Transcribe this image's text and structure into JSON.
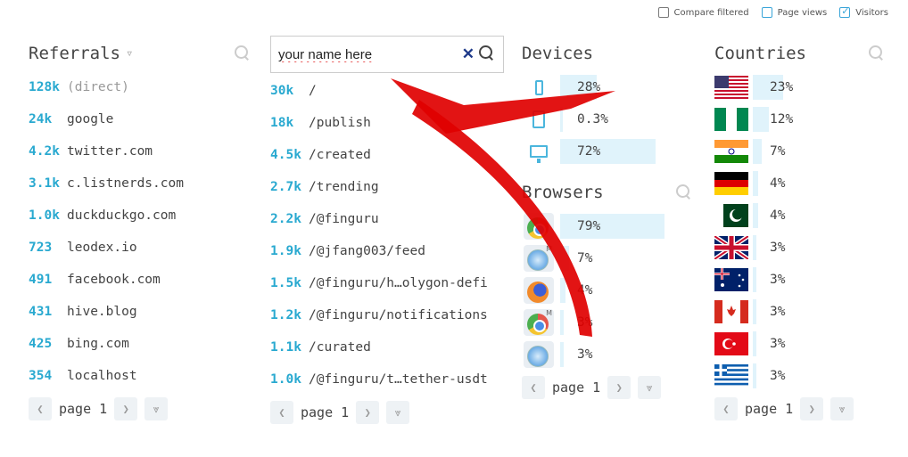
{
  "topbar": {
    "compare_label": "Compare filtered",
    "pageviews_label": "Page views",
    "visitors_label": "Visitors"
  },
  "referrals": {
    "title": "Referrals",
    "rows": [
      {
        "count": "128k",
        "label": "(direct)"
      },
      {
        "count": "24k",
        "label": "google"
      },
      {
        "count": "4.2k",
        "label": "twitter.com"
      },
      {
        "count": "3.1k",
        "label": "c.listnerds.com"
      },
      {
        "count": "1.0k",
        "label": "duckduckgo.com"
      },
      {
        "count": "723",
        "label": "leodex.io"
      },
      {
        "count": "491",
        "label": "facebook.com"
      },
      {
        "count": "431",
        "label": "hive.blog"
      },
      {
        "count": "425",
        "label": "bing.com"
      },
      {
        "count": "354",
        "label": "localhost"
      }
    ],
    "page_label": "page 1"
  },
  "pages": {
    "search_value": "your name here",
    "rows": [
      {
        "count": "30k",
        "label": "/"
      },
      {
        "count": "18k",
        "label": "/publish"
      },
      {
        "count": "4.5k",
        "label": "/created"
      },
      {
        "count": "2.7k",
        "label": "/trending"
      },
      {
        "count": "2.2k",
        "label": "/@finguru"
      },
      {
        "count": "1.9k",
        "label": "/@jfang003/feed"
      },
      {
        "count": "1.5k",
        "label": "/@finguru/h…olygon-defi"
      },
      {
        "count": "1.2k",
        "label": "/@finguru/notifications"
      },
      {
        "count": "1.1k",
        "label": "/curated"
      },
      {
        "count": "1.0k",
        "label": "/@finguru/t…tether-usdt"
      }
    ],
    "page_label": "page 1"
  },
  "devices": {
    "title": "Devices",
    "rows": [
      {
        "icon": "phone-icon",
        "pct": "28%",
        "share": 0.28
      },
      {
        "icon": "tablet-icon",
        "pct": "0.3%",
        "share": 0.003
      },
      {
        "icon": "desktop-icon",
        "pct": "72%",
        "share": 0.72
      }
    ]
  },
  "browsers": {
    "title": "Browsers",
    "rows": [
      {
        "icon": "chrome-icon",
        "pct": "79%",
        "share": 0.79
      },
      {
        "icon": "safari-mobile-icon",
        "pct": "7%",
        "share": 0.07
      },
      {
        "icon": "firefox-icon",
        "pct": "4%",
        "share": 0.04
      },
      {
        "icon": "chrome-mobile-icon",
        "pct": "3%",
        "share": 0.03
      },
      {
        "icon": "safari-icon",
        "pct": "3%",
        "share": 0.03
      }
    ],
    "page_label": "page 1"
  },
  "countries": {
    "title": "Countries",
    "rows": [
      {
        "icon": "flag-us-icon",
        "pct": "23%",
        "share": 0.23
      },
      {
        "icon": "flag-ng-icon",
        "pct": "12%",
        "share": 0.12
      },
      {
        "icon": "flag-in-icon",
        "pct": "7%",
        "share": 0.07
      },
      {
        "icon": "flag-de-icon",
        "pct": "4%",
        "share": 0.04
      },
      {
        "icon": "flag-pk-icon",
        "pct": "4%",
        "share": 0.04
      },
      {
        "icon": "flag-gb-icon",
        "pct": "3%",
        "share": 0.03
      },
      {
        "icon": "flag-au-icon",
        "pct": "3%",
        "share": 0.03
      },
      {
        "icon": "flag-ca-icon",
        "pct": "3%",
        "share": 0.03
      },
      {
        "icon": "flag-tr-icon",
        "pct": "3%",
        "share": 0.03
      },
      {
        "icon": "flag-gr-icon",
        "pct": "3%",
        "share": 0.03
      }
    ],
    "page_label": "page 1"
  },
  "colors": {
    "accent": "#29a9d0",
    "bar": "#e0f3fb",
    "arrow": "#e00000"
  }
}
